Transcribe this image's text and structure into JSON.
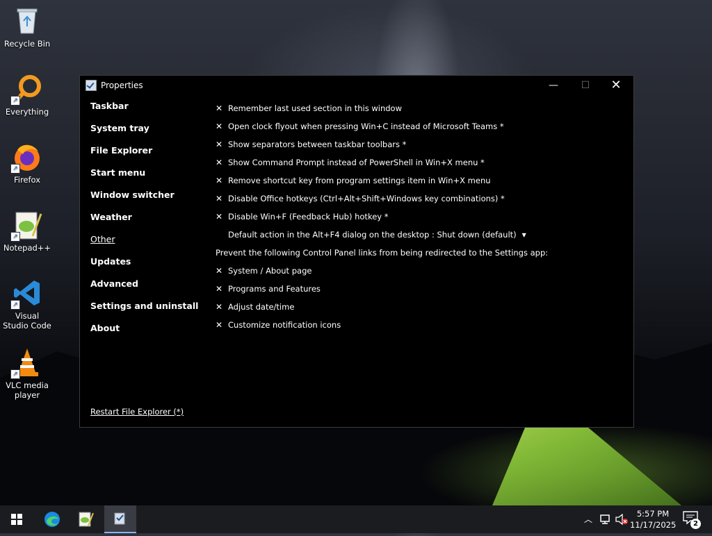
{
  "desktop": {
    "icons": [
      {
        "label": "Recycle Bin",
        "icon": "recycle-bin-icon"
      },
      {
        "label": "Everything",
        "icon": "everything-icon"
      },
      {
        "label": "Firefox",
        "icon": "firefox-icon"
      },
      {
        "label": "Notepad++",
        "icon": "notepadpp-icon"
      },
      {
        "label": "Visual Studio Code",
        "icon": "vscode-icon"
      },
      {
        "label": "VLC media player",
        "icon": "vlc-icon"
      }
    ]
  },
  "window": {
    "title": "Properties",
    "sidebar": [
      {
        "label": "Taskbar"
      },
      {
        "label": "System tray"
      },
      {
        "label": "File Explorer"
      },
      {
        "label": "Start menu"
      },
      {
        "label": "Window switcher"
      },
      {
        "label": "Weather"
      },
      {
        "label": "Other",
        "active": true
      },
      {
        "label": "Updates"
      },
      {
        "label": "Advanced"
      },
      {
        "label": "Settings and uninstall"
      },
      {
        "label": "About"
      }
    ],
    "restart_link": "Restart File Explorer (*)",
    "options": [
      {
        "label": "Remember last used section in this window",
        "checked": true
      },
      {
        "label": "Open clock flyout when pressing Win+C instead of Microsoft Teams *",
        "checked": true
      },
      {
        "label": "Show separators between taskbar toolbars *",
        "checked": true
      },
      {
        "label": "Show Command Prompt instead of PowerShell in Win+X menu *",
        "checked": true
      },
      {
        "label": "Remove shortcut key from program settings item in Win+X menu",
        "checked": true
      },
      {
        "label": "Disable Office hotkeys (Ctrl+Alt+Shift+Windows key combinations) *",
        "checked": true
      },
      {
        "label": "Disable Win+F (Feedback Hub) hotkey *",
        "checked": true
      },
      {
        "label": "Default action in the Alt+F4 dialog on the desktop : Shut down (default)",
        "dropdown": true
      },
      {
        "label": "Prevent the following Control Panel links from being redirected to the Settings app:",
        "heading": true
      },
      {
        "label": "System / About page",
        "checked": true
      },
      {
        "label": "Programs and Features",
        "checked": true
      },
      {
        "label": "Adjust date/time",
        "checked": true
      },
      {
        "label": "Customize notification icons",
        "checked": true
      }
    ],
    "check_glyph": "✕"
  },
  "taskbar": {
    "time": "5:57 PM",
    "date": "11/17/2025",
    "notification_count": "2"
  }
}
